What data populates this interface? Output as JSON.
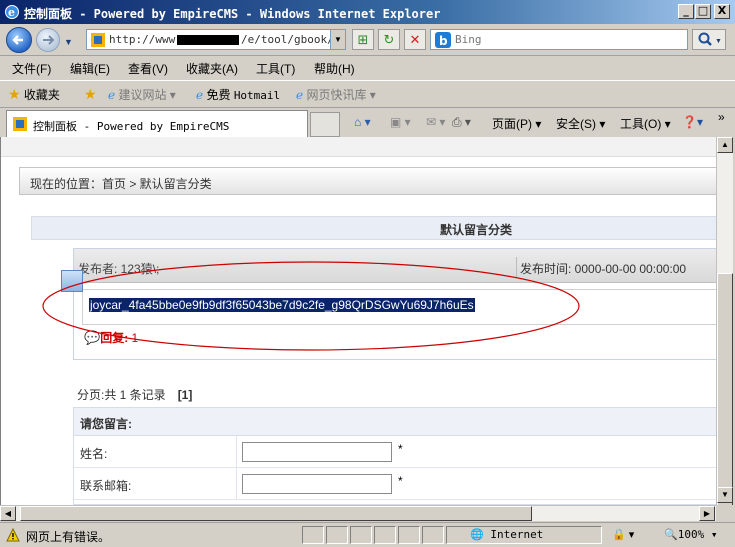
{
  "window": {
    "title": "控制面板 - Powered by EmpireCMS - Windows Internet Explorer",
    "minimize": "_",
    "maximize": "□",
    "close": "X"
  },
  "address": {
    "url_prefix": "http://www.",
    "url_suffix": "/e/tool/gbook/?"
  },
  "search": {
    "placeholder": "Bing"
  },
  "menu": {
    "file": "文件(F)",
    "edit": "编辑(E)",
    "view": "查看(V)",
    "favorites": "收藏夹(A)",
    "tools": "工具(T)",
    "help": "帮助(H)"
  },
  "favbar": {
    "favorites": "收藏夹",
    "suggested": "建议网站 ▾",
    "hotmail_prefix": "免费",
    "hotmail": "Hotmail",
    "webslice": "网页快讯库 ▾"
  },
  "tab": {
    "title": "控制面板 - Powered by EmpireCMS"
  },
  "commands": {
    "page": "页面(P) ▾",
    "safety": "安全(S) ▾",
    "tools": "工具(O) ▾",
    "more": "»"
  },
  "page": {
    "breadcrumb": "现在的位置：首页 > 默认留言分类",
    "section_title": "默认留言分类",
    "message": {
      "author": "发布者: 123猿\\;",
      "time": "发布时间: 0000-00-00 00:00:00",
      "content": "joycar_4fa45bbe0e9fb9df3f65043be7d9c2fe_g98QrDSGwYu69J7h6uEs",
      "reply_label": "回复:",
      "reply_count": "1"
    },
    "pager_text": "分页:共 1 条记录",
    "pager_current": "[1]",
    "form": {
      "title": "请您留言:",
      "name_label": "姓名:",
      "email_label": "联系邮箱:",
      "required": "*"
    }
  },
  "status": {
    "text": "网页上有错误。",
    "zone": "Internet",
    "zoom": "100%"
  },
  "colors": {
    "titlebar": "#0a246a",
    "selection": "#0a246a",
    "reply": "#d00000",
    "annotation": "#cc0000"
  }
}
